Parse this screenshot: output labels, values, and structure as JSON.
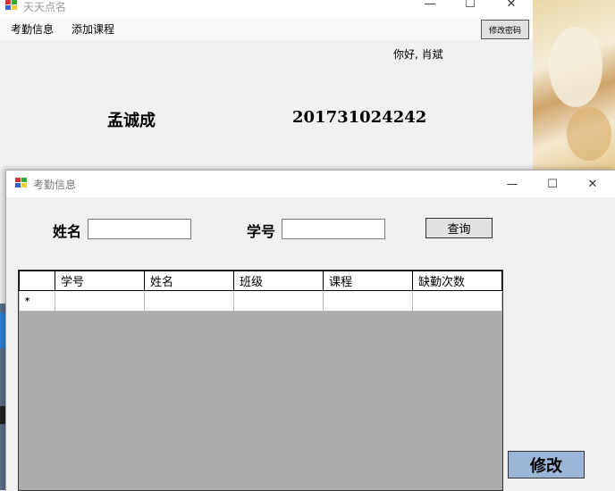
{
  "main_window": {
    "title": "天天点名",
    "menu": [
      "考勤信息",
      "添加课程"
    ],
    "change_password_label": "修改密码",
    "greeting": "你好, 肖斌",
    "user_name": "孟诚成",
    "user_id": "201731024242",
    "controls": {
      "minimize": "—",
      "maximize": "☐",
      "close": "✕"
    }
  },
  "attendance_window": {
    "title": "考勤信息",
    "name_label": "姓名",
    "name_value": "",
    "id_label": "学号",
    "id_value": "",
    "query_label": "查询",
    "table": {
      "columns": [
        "学号",
        "姓名",
        "班级",
        "课程",
        "缺勤次数"
      ],
      "new_row_marker": "*",
      "rows": []
    },
    "edit_label": "修改",
    "controls": {
      "minimize": "—",
      "maximize": "☐",
      "close": "✕"
    }
  }
}
